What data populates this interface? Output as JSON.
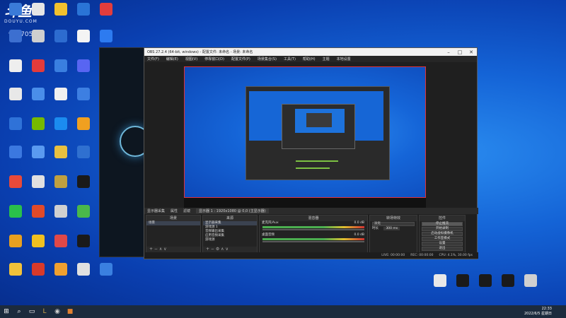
{
  "watermark": {
    "logo": "斗鱼",
    "sub": "DOUYU.COM",
    "room_id": "9677055"
  },
  "desktop_icons_left": [
    {
      "label": "",
      "color": "#3b7bd8"
    },
    {
      "label": "",
      "color": "#e5e5e5"
    },
    {
      "label": "",
      "color": "#f2c12e"
    },
    {
      "label": "",
      "color": "#2a74d6"
    },
    {
      "label": "",
      "color": "#e23d3d"
    },
    {
      "label": "",
      "color": "#3c6fd0"
    },
    {
      "label": "",
      "color": "#cfcfcf"
    },
    {
      "label": "",
      "color": "#2d6cd0"
    },
    {
      "label": "",
      "color": "#f4f4f4"
    },
    {
      "label": "",
      "color": "#2d7bf0"
    },
    {
      "label": "",
      "color": "#eeeeee"
    },
    {
      "label": "",
      "color": "#e33b3b"
    },
    {
      "label": "",
      "color": "#3a7fe0"
    },
    {
      "label": "",
      "color": "#5865f2"
    },
    {
      "label": "",
      "color": "#2f7de1"
    },
    {
      "label": "",
      "color": "#e8e8e8"
    },
    {
      "label": "",
      "color": "#4a8eea"
    },
    {
      "label": "",
      "color": "#f0f0f0"
    },
    {
      "label": "",
      "color": "#3d7fe2"
    },
    {
      "label": "",
      "color": "#d83030"
    },
    {
      "label": "",
      "color": "#2f72d8"
    },
    {
      "label": "",
      "color": "#76b900"
    },
    {
      "label": "",
      "color": "#1b8cf0"
    },
    {
      "label": "",
      "color": "#f0a020"
    },
    {
      "label": "",
      "color": "#e8e8e8"
    },
    {
      "label": "",
      "color": "#3b78e0"
    },
    {
      "label": "",
      "color": "#5a9af0"
    },
    {
      "label": "",
      "color": "#e8c040"
    },
    {
      "label": "",
      "color": "#2f70d0"
    },
    {
      "label": "",
      "color": "#1a1a1a"
    },
    {
      "label": "",
      "color": "#e84a3a"
    },
    {
      "label": "",
      "color": "#e0e0e0"
    },
    {
      "label": "",
      "color": "#c0a040"
    },
    {
      "label": "",
      "color": "#1a1a1a"
    },
    {
      "label": "",
      "color": "#f0f0f0"
    },
    {
      "label": "",
      "color": "#2ac04a"
    },
    {
      "label": "",
      "color": "#e04a2a"
    },
    {
      "label": "",
      "color": "#d0d0d0"
    },
    {
      "label": "",
      "color": "#4ab84a"
    },
    {
      "label": "",
      "color": "#e8e8e8"
    },
    {
      "label": "",
      "color": "#e8a020"
    },
    {
      "label": "",
      "color": "#f0c020"
    },
    {
      "label": "",
      "color": "#e04848"
    },
    {
      "label": "",
      "color": "#1a1a1a"
    },
    {
      "label": "",
      "color": "#d8d8d8"
    },
    {
      "label": "",
      "color": "#f2c23a"
    },
    {
      "label": "",
      "color": "#d83a2a"
    },
    {
      "label": "",
      "color": "#f0a030"
    },
    {
      "label": "",
      "color": "#e0e0e0"
    },
    {
      "label": "",
      "color": "#3a80e0"
    },
    {
      "label": "",
      "color": "#e8a040"
    }
  ],
  "obs": {
    "title": "OBS 27.2.4 (64-bit, windows) - 配置文件: 未命名 - 场景: 未命名",
    "menu": [
      "文件(F)",
      "编辑(E)",
      "视图(V)",
      "停靠窗口(D)",
      "配置文件(P)",
      "场景集合(S)",
      "工具(T)",
      "帮助(H)",
      "主题",
      "本地设置"
    ],
    "source_bar": [
      "显示器采集",
      "属性",
      "滤镜",
      "显示器 1 : 1920x1080 @ 0,0 (主显示器)"
    ],
    "docks": {
      "scenes": {
        "title": "场景",
        "items": [
          "场景"
        ]
      },
      "sources": {
        "title": "来源",
        "items": [
          "显示器采集",
          "游戏源 1",
          "音频输出采集",
          "应用音频采集",
          "游戏源"
        ]
      },
      "mixer": {
        "title": "混音器",
        "channels": [
          {
            "name": "麦克风/Aux",
            "db": "0.0 dB"
          },
          {
            "name": "桌面音频",
            "db": "0.0 dB"
          }
        ]
      },
      "transitions": {
        "title": "转场特效",
        "type": "淡化",
        "duration_label": "时长",
        "duration": "300 ms"
      },
      "controls": {
        "title": "控件",
        "buttons": [
          "停止推流",
          "开始录制",
          "启动虚拟摄像机",
          "工作室模式",
          "设置",
          "退出"
        ]
      }
    },
    "status": [
      "LIVE: 00:00:00",
      "REC: 00:00:00",
      "CPU: 4.1%, 30.00 fps"
    ]
  },
  "taskbar": {
    "time": "22:33",
    "date": "2022/6/5 星期日"
  },
  "right_icons": [
    {
      "label": "",
      "color": "#e8e8e8"
    },
    {
      "label": "",
      "color": "#1a1a1a"
    },
    {
      "label": "",
      "color": "#1a1a1a"
    },
    {
      "label": "",
      "color": "#1a1a1a"
    },
    {
      "label": "",
      "color": "#d0d0d0"
    }
  ]
}
